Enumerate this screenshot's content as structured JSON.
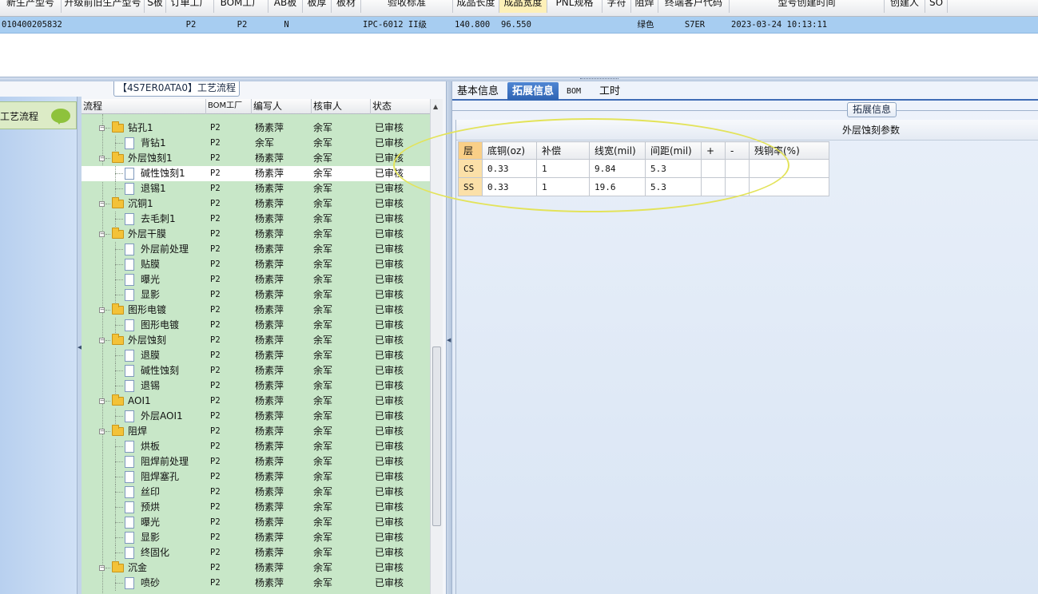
{
  "grid": {
    "columns": [
      {
        "label": "新生产型号",
        "selected": false
      },
      {
        "label": "升级前旧生产型号",
        "selected": false
      },
      {
        "label": "S板",
        "selected": false
      },
      {
        "label": "订单工厂",
        "selected": false
      },
      {
        "label": "BOM工厂",
        "selected": false
      },
      {
        "label": "AB板",
        "selected": false
      },
      {
        "label": "板厚",
        "selected": false
      },
      {
        "label": "板材",
        "selected": false
      },
      {
        "label": "验收标准",
        "selected": false
      },
      {
        "label": "成品长度",
        "selected": false
      },
      {
        "label": "成品宽度",
        "selected": true
      },
      {
        "label": "PNL规格",
        "selected": false
      },
      {
        "label": "字符",
        "selected": false
      },
      {
        "label": "阻焊",
        "selected": false
      },
      {
        "label": "终端客户代码",
        "selected": false
      },
      {
        "label": "型号创建时间",
        "selected": false
      },
      {
        "label": "创建人",
        "selected": false
      },
      {
        "label": "SO",
        "selected": false
      }
    ],
    "row": [
      "010400205832",
      "",
      "",
      "P2",
      "P2",
      "N",
      "",
      "",
      "IPC-6012 II级",
      "140.800",
      "96.550",
      "",
      "",
      "绿色",
      "S7ER",
      "2023-03-24 10:13:11",
      "",
      ""
    ]
  },
  "left_panel": {
    "title": "【4S7ER0ATA0】工艺流程",
    "nav_label": "工艺流程",
    "tree_headers": [
      "流程",
      "BOM工厂",
      "编写人",
      "核审人",
      "状态"
    ],
    "rows": [
      {
        "name": "钻孔1",
        "factory": "P2",
        "writer": "杨素萍",
        "reviewer": "余军",
        "status": "已审核",
        "type": "folder"
      },
      {
        "name": "背钻1",
        "factory": "P2",
        "writer": "余军",
        "reviewer": "余军",
        "status": "已审核",
        "type": "leaf"
      },
      {
        "name": "外层蚀刻1",
        "factory": "P2",
        "writer": "杨素萍",
        "reviewer": "余军",
        "status": "已审核",
        "type": "folder"
      },
      {
        "name": "碱性蚀刻1",
        "factory": "P2",
        "writer": "杨素萍",
        "reviewer": "余军",
        "status": "已审核",
        "type": "leaf",
        "highlighted": true
      },
      {
        "name": "退锡1",
        "factory": "P2",
        "writer": "杨素萍",
        "reviewer": "余军",
        "status": "已审核",
        "type": "leaf"
      },
      {
        "name": "沉铜1",
        "factory": "P2",
        "writer": "杨素萍",
        "reviewer": "余军",
        "status": "已审核",
        "type": "folder"
      },
      {
        "name": "去毛刺1",
        "factory": "P2",
        "writer": "杨素萍",
        "reviewer": "余军",
        "status": "已审核",
        "type": "leaf"
      },
      {
        "name": "外层干膜",
        "factory": "P2",
        "writer": "杨素萍",
        "reviewer": "余军",
        "status": "已审核",
        "type": "folder"
      },
      {
        "name": "外层前处理",
        "factory": "P2",
        "writer": "杨素萍",
        "reviewer": "余军",
        "status": "已审核",
        "type": "leaf"
      },
      {
        "name": "贴膜",
        "factory": "P2",
        "writer": "杨素萍",
        "reviewer": "余军",
        "status": "已审核",
        "type": "leaf"
      },
      {
        "name": "曝光",
        "factory": "P2",
        "writer": "杨素萍",
        "reviewer": "余军",
        "status": "已审核",
        "type": "leaf"
      },
      {
        "name": "显影",
        "factory": "P2",
        "writer": "杨素萍",
        "reviewer": "余军",
        "status": "已审核",
        "type": "leaf"
      },
      {
        "name": "图形电镀",
        "factory": "P2",
        "writer": "杨素萍",
        "reviewer": "余军",
        "status": "已审核",
        "type": "folder"
      },
      {
        "name": "图形电镀",
        "factory": "P2",
        "writer": "杨素萍",
        "reviewer": "余军",
        "status": "已审核",
        "type": "leaf"
      },
      {
        "name": "外层蚀刻",
        "factory": "P2",
        "writer": "杨素萍",
        "reviewer": "余军",
        "status": "已审核",
        "type": "folder"
      },
      {
        "name": "退膜",
        "factory": "P2",
        "writer": "杨素萍",
        "reviewer": "余军",
        "status": "已审核",
        "type": "leaf"
      },
      {
        "name": "碱性蚀刻",
        "factory": "P2",
        "writer": "杨素萍",
        "reviewer": "余军",
        "status": "已审核",
        "type": "leaf"
      },
      {
        "name": "退锡",
        "factory": "P2",
        "writer": "杨素萍",
        "reviewer": "余军",
        "status": "已审核",
        "type": "leaf"
      },
      {
        "name": "AOI1",
        "factory": "P2",
        "writer": "杨素萍",
        "reviewer": "余军",
        "status": "已审核",
        "type": "folder"
      },
      {
        "name": "外层AOI1",
        "factory": "P2",
        "writer": "杨素萍",
        "reviewer": "余军",
        "status": "已审核",
        "type": "leaf"
      },
      {
        "name": "阻焊",
        "factory": "P2",
        "writer": "杨素萍",
        "reviewer": "余军",
        "status": "已审核",
        "type": "folder"
      },
      {
        "name": "烘板",
        "factory": "P2",
        "writer": "杨素萍",
        "reviewer": "余军",
        "status": "已审核",
        "type": "leaf"
      },
      {
        "name": "阻焊前处理",
        "factory": "P2",
        "writer": "杨素萍",
        "reviewer": "余军",
        "status": "已审核",
        "type": "leaf"
      },
      {
        "name": "阻焊塞孔",
        "factory": "P2",
        "writer": "杨素萍",
        "reviewer": "余军",
        "status": "已审核",
        "type": "leaf"
      },
      {
        "name": "丝印",
        "factory": "P2",
        "writer": "杨素萍",
        "reviewer": "余军",
        "status": "已审核",
        "type": "leaf"
      },
      {
        "name": "预烘",
        "factory": "P2",
        "writer": "杨素萍",
        "reviewer": "余军",
        "status": "已审核",
        "type": "leaf"
      },
      {
        "name": "曝光",
        "factory": "P2",
        "writer": "杨素萍",
        "reviewer": "余军",
        "status": "已审核",
        "type": "leaf"
      },
      {
        "name": "显影",
        "factory": "P2",
        "writer": "杨素萍",
        "reviewer": "余军",
        "status": "已审核",
        "type": "leaf"
      },
      {
        "name": "终固化",
        "factory": "P2",
        "writer": "杨素萍",
        "reviewer": "余军",
        "status": "已审核",
        "type": "leaf"
      },
      {
        "name": "沉金",
        "factory": "P2",
        "writer": "杨素萍",
        "reviewer": "余军",
        "status": "已审核",
        "type": "folder"
      },
      {
        "name": "喷砂",
        "factory": "P2",
        "writer": "杨素萍",
        "reviewer": "余军",
        "status": "已审核",
        "type": "leaf"
      }
    ]
  },
  "right_panel": {
    "tabs": [
      {
        "label": "基本信息",
        "active": false
      },
      {
        "label": "拓展信息",
        "active": true
      },
      {
        "label": "BOM",
        "active": false
      },
      {
        "label": "工时",
        "active": false
      }
    ],
    "group_label": "拓展信息",
    "section_title": "外层蚀刻参数",
    "table": {
      "headers": [
        "层",
        "底铜(oz)",
        "补偿",
        "线宽(mil)",
        "间距(mil)",
        "+",
        "-",
        "残铜率(%)"
      ],
      "rows": [
        [
          "CS",
          "0.33",
          "1",
          "9.84",
          "5.3",
          "",
          "",
          ""
        ],
        [
          "SS",
          "0.33",
          "1",
          "19.6",
          "5.3",
          "",
          "",
          ""
        ]
      ]
    }
  },
  "colors": {
    "selected_row": "#a7cdf1",
    "tree_background": "#c8e7c8",
    "active_tab": "#2f63b2",
    "highlight_ring": "#e3e35a"
  }
}
